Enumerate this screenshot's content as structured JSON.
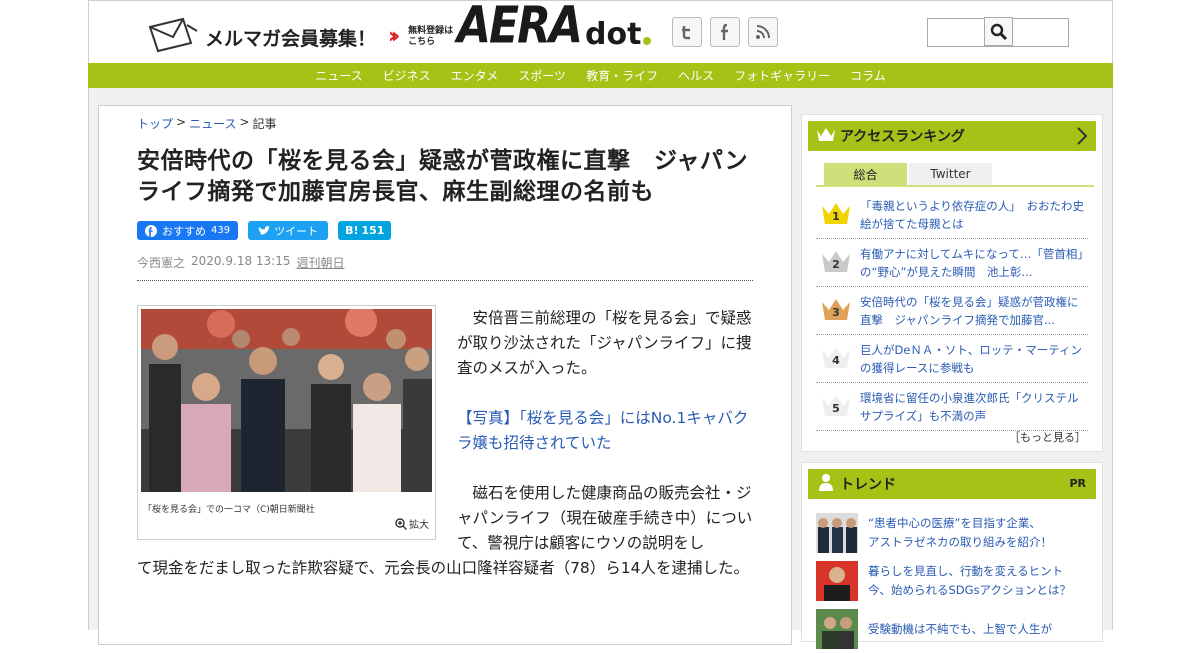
{
  "header": {
    "mailmag_label": "メルマガ会員募集！",
    "free_line1": "無料登録は",
    "free_line2": "こちら",
    "logo_main": "AERA",
    "logo_sub": "dot",
    "social": [
      {
        "name": "twitter",
        "glyph": "t"
      },
      {
        "name": "facebook",
        "glyph": "f"
      },
      {
        "name": "rss",
        "glyph": "rss"
      }
    ],
    "search_placeholder": ""
  },
  "nav": [
    "ニュース",
    "ビジネス",
    "エンタメ",
    "スポーツ",
    "教育・ライフ",
    "ヘルス",
    "フォトギャラリー",
    "コラム"
  ],
  "breadcrumb": {
    "top": "トップ",
    "news": "ニュース",
    "current": "記事",
    "sep": ">"
  },
  "article": {
    "title": "安倍時代の「桜を見る会」疑惑が菅政権に直撃　ジャパンライフ摘発で加藤官房長官、麻生副総理の名前も",
    "fb_label": "おすすめ",
    "fb_count": "439",
    "tw_label": "ツイート",
    "hb_label": "B!",
    "hb_count": "151",
    "author": "今西憲之",
    "date": "2020.9.18 13:15",
    "magazine": "週刊朝日",
    "photo_caption": "「桜を見る会」での一コマ（C)朝日新聞社",
    "zoom_label": "拡大",
    "para1": "　安倍晋三前総理の「桜を見る会」で疑惑が取り沙汰された「ジャパンライフ」に捜査のメスが入った。",
    "photo_link": "【写真】「桜を見る会」にはNo.1キャバクラ嬢も招待されていた",
    "para2_a": "　磁石を使用した健康商品の販売会社・ジャパンライフ（現在破産手続き中）について、警視庁は顧客にウソの説明をし",
    "para2_b": "て現金をだまし取った詐欺容疑で、元会長の山口隆祥容疑者（78）ら14人を逮捕した。"
  },
  "ranking": {
    "title": "アクセスランキング",
    "tabs": [
      "総合",
      "Twitter"
    ],
    "items": [
      {
        "rank": "1",
        "text": "「毒親というより依存症の人」　おおたわ史絵が捨てた母親とは"
      },
      {
        "rank": "2",
        "text": "有働アナに対してムキになって…「菅首相」の“野心”が見えた瞬間　池上彰..."
      },
      {
        "rank": "3",
        "text": "安倍時代の「桜を見る会」疑惑が菅政権に直撃　ジャパンライフ摘発で加藤官..."
      },
      {
        "rank": "4",
        "text": "巨人がDeＮＡ・ソト、ロッテ・マーティンの獲得レースに参戦も"
      },
      {
        "rank": "5",
        "text": "環境省に留任の小泉進次郎氏「クリステルサプライズ」も不満の声"
      }
    ],
    "more": "［もっと見る］"
  },
  "trend": {
    "title": "トレンド",
    "pr": "PR",
    "items": [
      {
        "text1": "“患者中心の医療”を目指す企業、",
        "text2": "アストラゼネカの取り組みを紹介！"
      },
      {
        "text1": "暮らしを見直し、行動を変えるヒント",
        "text2": "今、始められるSDGsアクションとは？"
      },
      {
        "text1": "受験動機は不純でも、上智で人生が",
        "text2": ""
      }
    ]
  },
  "colors": {
    "accent_green": "#a6c216",
    "link_blue": "#2a5bb3",
    "facebook": "#1877f2",
    "twitter": "#1da1f2",
    "hatena": "#00a4de",
    "mailmag_arrow": "#d6202a"
  }
}
